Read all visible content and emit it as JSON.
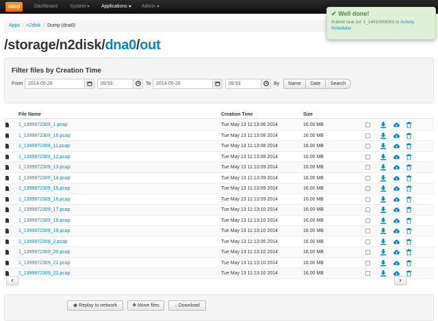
{
  "navbar": {
    "brand": "ntop",
    "items": [
      {
        "label": "Dashboard",
        "dropdown": false,
        "active": false
      },
      {
        "label": "System",
        "dropdown": true,
        "active": false
      },
      {
        "label": "Applications",
        "dropdown": true,
        "active": true
      },
      {
        "label": "Admin",
        "dropdown": true,
        "active": false
      }
    ]
  },
  "breadcrumb": [
    "Apps",
    "n2disk",
    "Dump (dna0)"
  ],
  "title": {
    "prefix": "/storage/n2disk/",
    "link1": "dna0",
    "sep": "/",
    "link2": "out"
  },
  "filter": {
    "heading": "Filter files by Creation Time",
    "from_label": "From",
    "from_date": "2014-05-26",
    "from_time": "09:53",
    "to_label": "To",
    "to_date": "2014-05-26",
    "to_time": "09:53",
    "by_label": "By",
    "name_btn": "Name",
    "date_btn": "Date",
    "search_btn": "Search"
  },
  "table": {
    "headers": {
      "name": "File Name",
      "date": "Creation Time",
      "size": "Size"
    },
    "rows": [
      {
        "name": "1_1399972309_1.pcap",
        "date": "Tue May 13 11:13:06 2014",
        "size": "16.00 MB"
      },
      {
        "name": "1_1399972309_10.pcap",
        "date": "Tue May 13 11:13:08 2014",
        "size": "16.00 MB"
      },
      {
        "name": "1_1399972309_11.pcap",
        "date": "Tue May 13 11:13:08 2014",
        "size": "16.00 MB"
      },
      {
        "name": "1_1399972309_12.pcap",
        "date": "Tue May 13 11:13:08 2014",
        "size": "16.00 MB"
      },
      {
        "name": "1_1399972309_13.pcap",
        "date": "Tue May 13 11:13:09 2014",
        "size": "16.00 MB"
      },
      {
        "name": "1_1399972309_14.pcap",
        "date": "Tue May 13 11:13:09 2014",
        "size": "16.00 MB"
      },
      {
        "name": "1_1399972309_15.pcap",
        "date": "Tue May 13 11:13:09 2014",
        "size": "16.00 MB"
      },
      {
        "name": "1_1399972309_16.pcap",
        "date": "Tue May 13 11:13:09 2014",
        "size": "16.00 MB"
      },
      {
        "name": "1_1399972309_17.pcap",
        "date": "Tue May 13 11:13:10 2014",
        "size": "16.00 MB"
      },
      {
        "name": "1_1399972309_18.pcap",
        "date": "Tue May 13 11:13:10 2014",
        "size": "16.00 MB"
      },
      {
        "name": "1_1399972309_19.pcap",
        "date": "Tue May 13 11:13:10 2014",
        "size": "16.00 MB"
      },
      {
        "name": "1_1399972309_2.pcap",
        "date": "Tue May 13 11:13:06 2014",
        "size": "16.00 MB"
      },
      {
        "name": "1_1399972309_20.pcap",
        "date": "Tue May 13 11:13:10 2014",
        "size": "16.00 MB"
      },
      {
        "name": "1_1399972309_21.pcap",
        "date": "Tue May 13 11:13:10 2014",
        "size": "16.00 MB"
      },
      {
        "name": "1_1399972309_22.pcap",
        "date": "Tue May 13 11:13:10 2014",
        "size": "16.00 MB"
      }
    ]
  },
  "pager": {
    "prev": "‹",
    "next": "›"
  },
  "actions": {
    "replay": "Replay to network",
    "move": "Move files",
    "download": "Download"
  },
  "toast": {
    "title": "Well done!",
    "body_prefix": "Submit task (id: 1_1401090830) to ",
    "body_link": "Activity Scheduler",
    "body_suffix": "."
  },
  "colors": {
    "link": "#0088cc",
    "brand": "#f08a1c",
    "success_bg": "#dff0d8",
    "success_text": "#468847"
  }
}
